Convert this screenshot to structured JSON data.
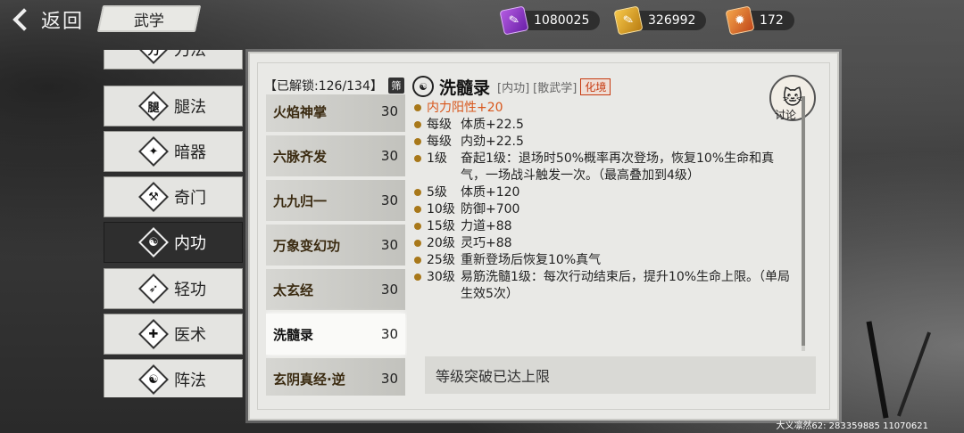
{
  "topbar": {
    "back_label": "返回",
    "section_title": "武学",
    "currencies": [
      {
        "icon": "purple-book-icon",
        "color": "#8a34c8",
        "value": "1080025"
      },
      {
        "icon": "gold-book-icon",
        "color": "#d9a020",
        "value": "326992"
      },
      {
        "icon": "orange-flame-icon",
        "color": "#e0701f",
        "value": "172"
      }
    ]
  },
  "categories": [
    {
      "label": "刀法",
      "glyph": "刀",
      "active": false
    },
    {
      "label": "腿法",
      "glyph": "腿",
      "active": false
    },
    {
      "label": "暗器",
      "glyph": "✦",
      "active": false
    },
    {
      "label": "奇门",
      "glyph": "⚒",
      "active": false
    },
    {
      "label": "内功",
      "glyph": "☯",
      "active": true
    },
    {
      "label": "轻功",
      "glyph": "➶",
      "active": false
    },
    {
      "label": "医术",
      "glyph": "✚",
      "active": false
    },
    {
      "label": "阵法",
      "glyph": "☯",
      "active": false
    }
  ],
  "unlock": {
    "label": "【已解锁:126/134】",
    "filter": "筛"
  },
  "skills": [
    {
      "name": "火焰神掌",
      "level": "30",
      "selected": false
    },
    {
      "name": "六脉齐发",
      "level": "30",
      "selected": false
    },
    {
      "name": "九九归一",
      "level": "30",
      "selected": false
    },
    {
      "name": "万象变幻功",
      "level": "30",
      "selected": false
    },
    {
      "name": "太玄经",
      "level": "30",
      "selected": false
    },
    {
      "name": "洗髓录",
      "level": "30",
      "selected": true
    },
    {
      "name": "玄阴真经·逆",
      "level": "30",
      "selected": false
    }
  ],
  "detail": {
    "title": "洗髓录",
    "tag_type": "[内功]",
    "tag_category": "[散武学]",
    "realm": "化境",
    "lines": [
      {
        "lv": "",
        "text": "内力阳性+20",
        "highlight": true
      },
      {
        "lv": "每级",
        "text": "体质+22.5"
      },
      {
        "lv": "每级",
        "text": "内劲+22.5"
      },
      {
        "lv": "1级",
        "text": "奋起1级：退场时50%概率再次登场，恢复10%生命和真气，一场战斗触发一次。（最高叠加到4级）"
      },
      {
        "lv": "5级",
        "text": "体质+120"
      },
      {
        "lv": "10级",
        "text": "防御+700"
      },
      {
        "lv": "15级",
        "text": "力道+88"
      },
      {
        "lv": "20级",
        "text": "灵巧+88"
      },
      {
        "lv": "25级",
        "text": "重新登场后恢复10%真气"
      },
      {
        "lv": "30级",
        "text": "易筋洗髓1级：每次行动结束后，提升10%生命上限。（单局生效5次）"
      }
    ],
    "discuss_label": "讨论",
    "breakthrough": "等级突破已达上限"
  },
  "footer": {
    "text": "大义凛然62: 283359885  11070621"
  }
}
